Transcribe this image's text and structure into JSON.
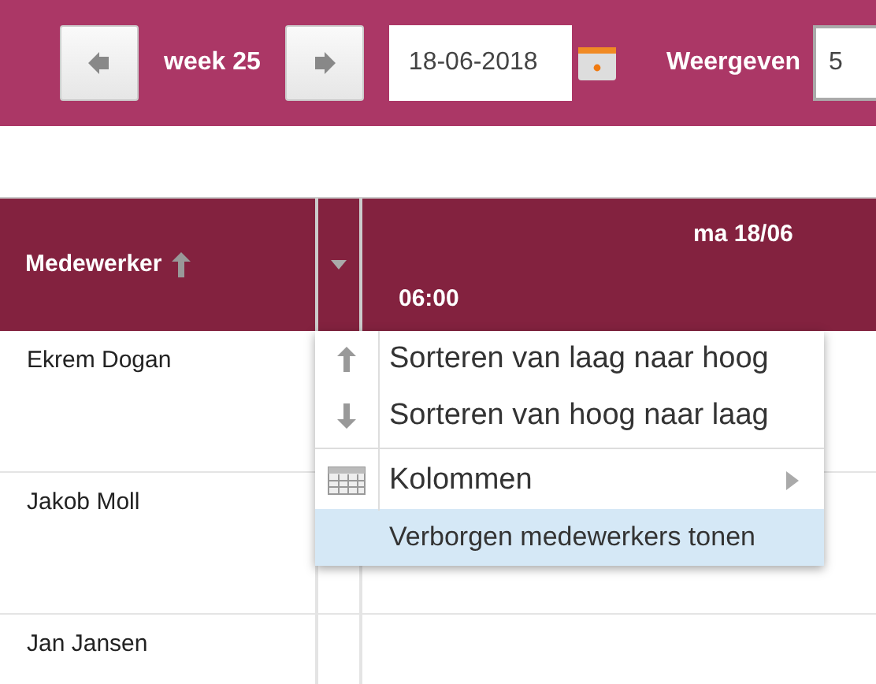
{
  "toolbar": {
    "week_label": "week 25",
    "date_value": "18-06-2018",
    "view_label": "Weergeven",
    "view_value": "5"
  },
  "table": {
    "columns": [
      {
        "label": "Medewerker",
        "sorted_ascending": true
      },
      {
        "label": "ma 18/06",
        "sub_label": "06:00"
      }
    ],
    "rows": [
      {
        "name": "Ekrem Dogan"
      },
      {
        "name": "Jakob Moll"
      },
      {
        "name": "Jan Jansen"
      }
    ]
  },
  "column_menu": {
    "items": [
      {
        "kind": "sort-asc",
        "label": "Sorteren van laag naar hoog",
        "selected": false
      },
      {
        "kind": "sort-desc",
        "label": "Sorteren van hoog naar laag",
        "selected": false
      },
      {
        "kind": "separator"
      },
      {
        "kind": "columns",
        "label": "Kolommen",
        "selected": false,
        "submenu": true
      },
      {
        "kind": "plain",
        "label": "Verborgen medewerkers tonen",
        "selected": true
      }
    ]
  }
}
